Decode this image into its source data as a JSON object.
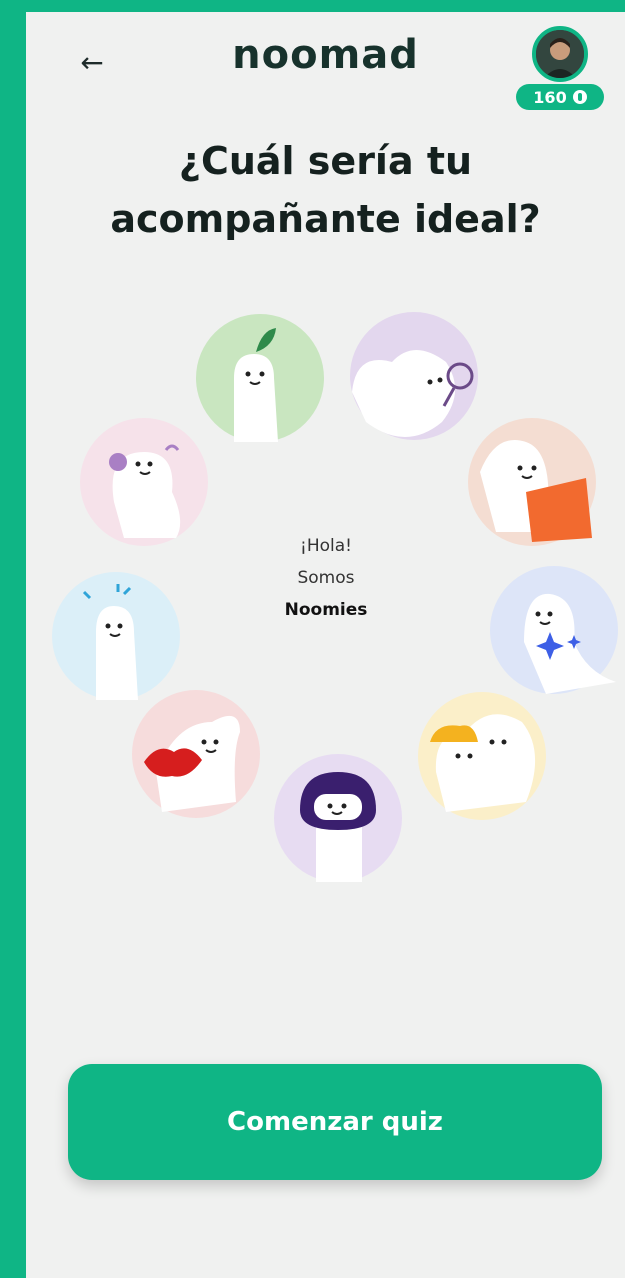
{
  "header": {
    "back_icon": "←",
    "logo": "noomad",
    "points": "160"
  },
  "title_line1": "¿Cuál sería tu",
  "title_line2": "acompañante ideal?",
  "center": {
    "line1": "¡Hola!",
    "line2": "Somos",
    "line3": "Noomies"
  },
  "cta_label": "Comenzar quiz",
  "colors": {
    "brand": "#0fb585",
    "background": "#f0f1f0",
    "text": "#15211f"
  },
  "noomies": [
    {
      "name": "leaf-noomie",
      "bg": "#c9e6c0"
    },
    {
      "name": "magnifier-noomie",
      "bg": "#e3d7ee"
    },
    {
      "name": "book-noomie",
      "bg": "#f4ddd2"
    },
    {
      "name": "sparkle-noomie",
      "bg": "#dde5f8"
    },
    {
      "name": "hat-noomie",
      "bg": "#fbefc9"
    },
    {
      "name": "helmet-noomie",
      "bg": "#e7dcf2"
    },
    {
      "name": "lips-noomie",
      "bg": "#f6dcdc"
    },
    {
      "name": "blue-noomie",
      "bg": "#dbeff8"
    },
    {
      "name": "flower-noomie",
      "bg": "#f6e2ea"
    }
  ]
}
